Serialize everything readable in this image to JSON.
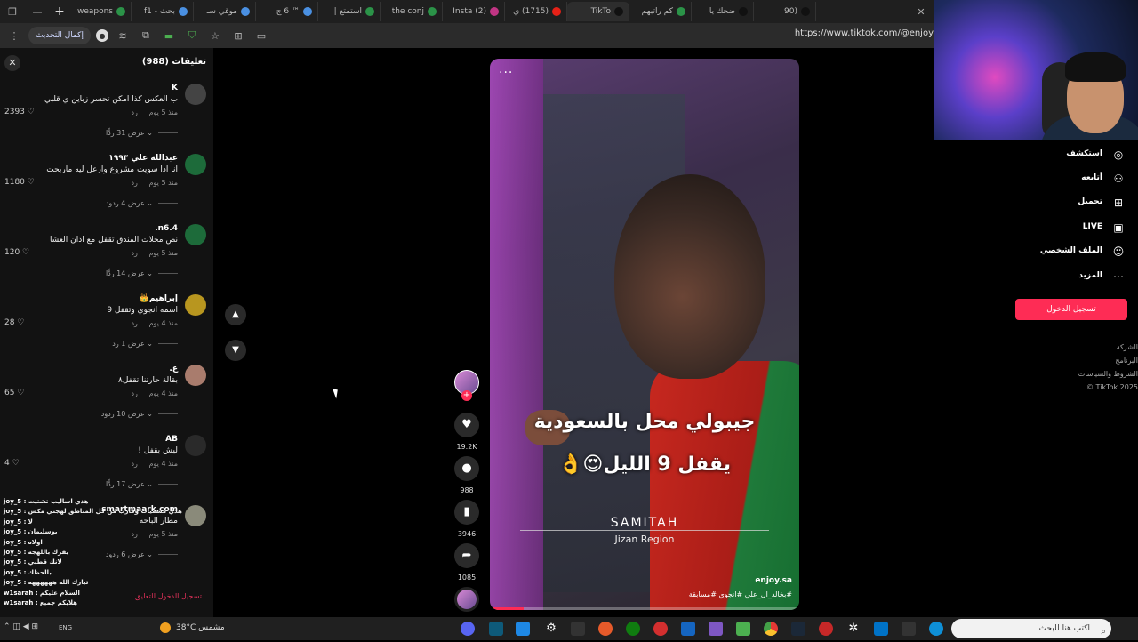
{
  "browser": {
    "tabs": [
      {
        "label": "weapons",
        "color": "#2b9348"
      },
      {
        "label": "بحث - f1",
        "color": "#4a90e2"
      },
      {
        "label": "موقي سـ",
        "color": "#4a90e2"
      },
      {
        "label": "™ 6 ج",
        "color": "#4a90e2"
      },
      {
        "label": "استمتع |",
        "color": "#2b9348"
      },
      {
        "label": "the conj",
        "color": "#2b9348"
      },
      {
        "label": "(2) Insta",
        "color": "#c13584"
      },
      {
        "label": "(1715) ي",
        "color": "#e62117"
      },
      {
        "label": "TikTo",
        "color": "#111111"
      },
      {
        "label": "كم راتبهم",
        "color": "#2b9348"
      },
      {
        "label": "ضحك يا",
        "color": "#111111"
      },
      {
        "label": "(90",
        "color": "#111111"
      }
    ],
    "update_label": "إكمال التحديث",
    "url": "https://www.tiktok.com/@enjoy"
  },
  "comments_panel": {
    "title": "تعليقات (988)",
    "close_icon": "close-icon",
    "comments": [
      {
        "user": "K",
        "text": "ب العكس كذا امكن تحسر زباين ي قلبي",
        "time": "منذ 5 يوم",
        "reply": "رد",
        "likes": "2393",
        "replies": "عرض 31 ردًّا",
        "avatar": "#444444"
      },
      {
        "user": "عبدالله علي ١٩٩٣",
        "text": "انا اذا سويت مشروع وازعل ليه ماربحت",
        "time": "منذ 5 يوم",
        "reply": "رد",
        "likes": "1180",
        "replies": "عرض 4 ردود",
        "avatar": "#1d6b3a"
      },
      {
        "user": "n6.4.",
        "text": "نص محلات المندق تقفل مع اذان العشا",
        "time": "منذ 5 يوم",
        "reply": "رد",
        "likes": "120",
        "replies": "عرض 14 ردًّا",
        "avatar": "#1d6b3a"
      },
      {
        "user": "إبراهيم👑",
        "text": "اسمه انجوي وتقفل 9",
        "time": "منذ 4 يوم",
        "reply": "رد",
        "likes": "28",
        "replies": "عرض 1 رد",
        "avatar": "#b8961f"
      },
      {
        "user": "ع.",
        "text": "بقالة حارتنا تقفل٨",
        "time": "منذ 4 يوم",
        "reply": "رد",
        "likes": "65",
        "replies": "عرض 10 ردود",
        "avatar": "#a97c6d"
      },
      {
        "user": "AB",
        "text": "ليش يقفل !",
        "time": "منذ 4 يوم",
        "reply": "رد",
        "likes": "4",
        "replies": "عرض 17 ردًّا",
        "avatar": "#2a2a2a"
      },
      {
        "user": "smartmaark.com",
        "text": "مطار الباحه",
        "time": "منذ 5 يوم",
        "reply": "رد",
        "likes": "",
        "replies": "عرض 6 ردود",
        "avatar": "#8a8a7a"
      }
    ]
  },
  "chat_overlay": {
    "lines": [
      {
        "user": "joy_5 :",
        "msg": "هذي اساليب تشتيت"
      },
      {
        "user": "joy_5 :",
        "msg": "هذي مسميات وقارب من كل المناطق لهجتي مكس"
      },
      {
        "user": "joy_5 :",
        "msg": "لا"
      },
      {
        "user": "joy_5 :",
        "msg": "بوسليمان"
      },
      {
        "user": "joy_5 :",
        "msg": "اولاه"
      },
      {
        "user": "joy_5 :",
        "msg": "يفرك باللهجه"
      },
      {
        "user": "joy_5 :",
        "msg": "لانك قطبي"
      },
      {
        "user": "joy_5 :",
        "msg": "بالحظك"
      },
      {
        "user": "joy_5 :",
        "msg": "تبارك الله ههههههه"
      },
      {
        "user": "w1sarah :",
        "msg": "السلام عليكم"
      },
      {
        "user": "w1sarah :",
        "msg": "هلابكم جميع"
      }
    ],
    "login_prompt": "تسجيل الدخول للتعليق"
  },
  "feed_nav": {
    "up_icon": "chevron-up-icon",
    "down_icon": "chevron-down-icon"
  },
  "video": {
    "menu": "...",
    "caption_line1": "جيبولي محل بالسعودية",
    "caption_line2": "يقفل 9 الليل😍👌",
    "watermark_brand": "SAMITAH",
    "watermark_region": "Jizan Region",
    "author": "enjoy.sa",
    "hashtags": "#بخالد_ال_علي #انجوي #مسابقة",
    "progress": 0.11
  },
  "actions": {
    "likes": "19.2K",
    "comments": "988",
    "saves": "3946",
    "shares": "1085"
  },
  "sidebar": {
    "nav": [
      {
        "label": "استكشف",
        "icon": "compass-icon",
        "glyph": "◎"
      },
      {
        "label": "أتابعه",
        "icon": "user-plus-icon",
        "glyph": "⚇"
      },
      {
        "label": "تحميل",
        "icon": "upload-icon",
        "glyph": "⊞"
      },
      {
        "label": "LIVE",
        "icon": "live-icon",
        "glyph": "▣"
      },
      {
        "label": "الملف الشخصي",
        "icon": "profile-icon",
        "glyph": "☺"
      },
      {
        "label": "المزيد",
        "icon": "more-icon",
        "glyph": "⋯"
      }
    ],
    "login_button": "تسجيل الدخول",
    "footer": [
      "الشركة",
      "البرنامج",
      "الشروط والسياسات",
      "TikTok 2025 ©"
    ]
  },
  "taskbar": {
    "weather": "38°C  مشمس",
    "search_placeholder": "اكتب هنا للبحث",
    "lang": "ENG"
  }
}
